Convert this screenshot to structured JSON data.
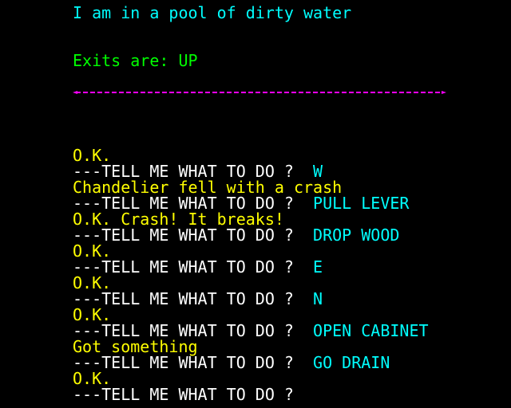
{
  "room": {
    "description": "I am in a pool of dirty water",
    "exits": "Exits are: UP"
  },
  "colors": {
    "background": "#000000",
    "room_text": "#00ffff",
    "exits_text": "#00ff00",
    "divider": "#ff00ff",
    "message_text": "#ffff00",
    "prompt_text": "#ffffff",
    "command_text": "#00ffff"
  },
  "log": [
    {
      "type": "message",
      "text": "O.K."
    },
    {
      "type": "prompt",
      "prompt": "---TELL ME WHAT TO DO ?  ",
      "command": "W"
    },
    {
      "type": "message",
      "text": "Chandelier fell with a crash"
    },
    {
      "type": "prompt",
      "prompt": "---TELL ME WHAT TO DO ?  ",
      "command": "PULL LEVER"
    },
    {
      "type": "message",
      "text": "O.K. Crash! It breaks!"
    },
    {
      "type": "prompt",
      "prompt": "---TELL ME WHAT TO DO ?  ",
      "command": "DROP WOOD"
    },
    {
      "type": "message",
      "text": "O.K."
    },
    {
      "type": "prompt",
      "prompt": "---TELL ME WHAT TO DO ?  ",
      "command": "E"
    },
    {
      "type": "message",
      "text": "O.K."
    },
    {
      "type": "prompt",
      "prompt": "---TELL ME WHAT TO DO ?  ",
      "command": "N"
    },
    {
      "type": "message",
      "text": "O.K."
    },
    {
      "type": "prompt",
      "prompt": "---TELL ME WHAT TO DO ?  ",
      "command": "OPEN CABINET"
    },
    {
      "type": "message",
      "text": "Got something"
    },
    {
      "type": "prompt",
      "prompt": "---TELL ME WHAT TO DO ?  ",
      "command": "GO DRAIN"
    },
    {
      "type": "message",
      "text": "O.K."
    },
    {
      "type": "prompt",
      "prompt": "---TELL ME WHAT TO DO ?",
      "command": ""
    }
  ]
}
